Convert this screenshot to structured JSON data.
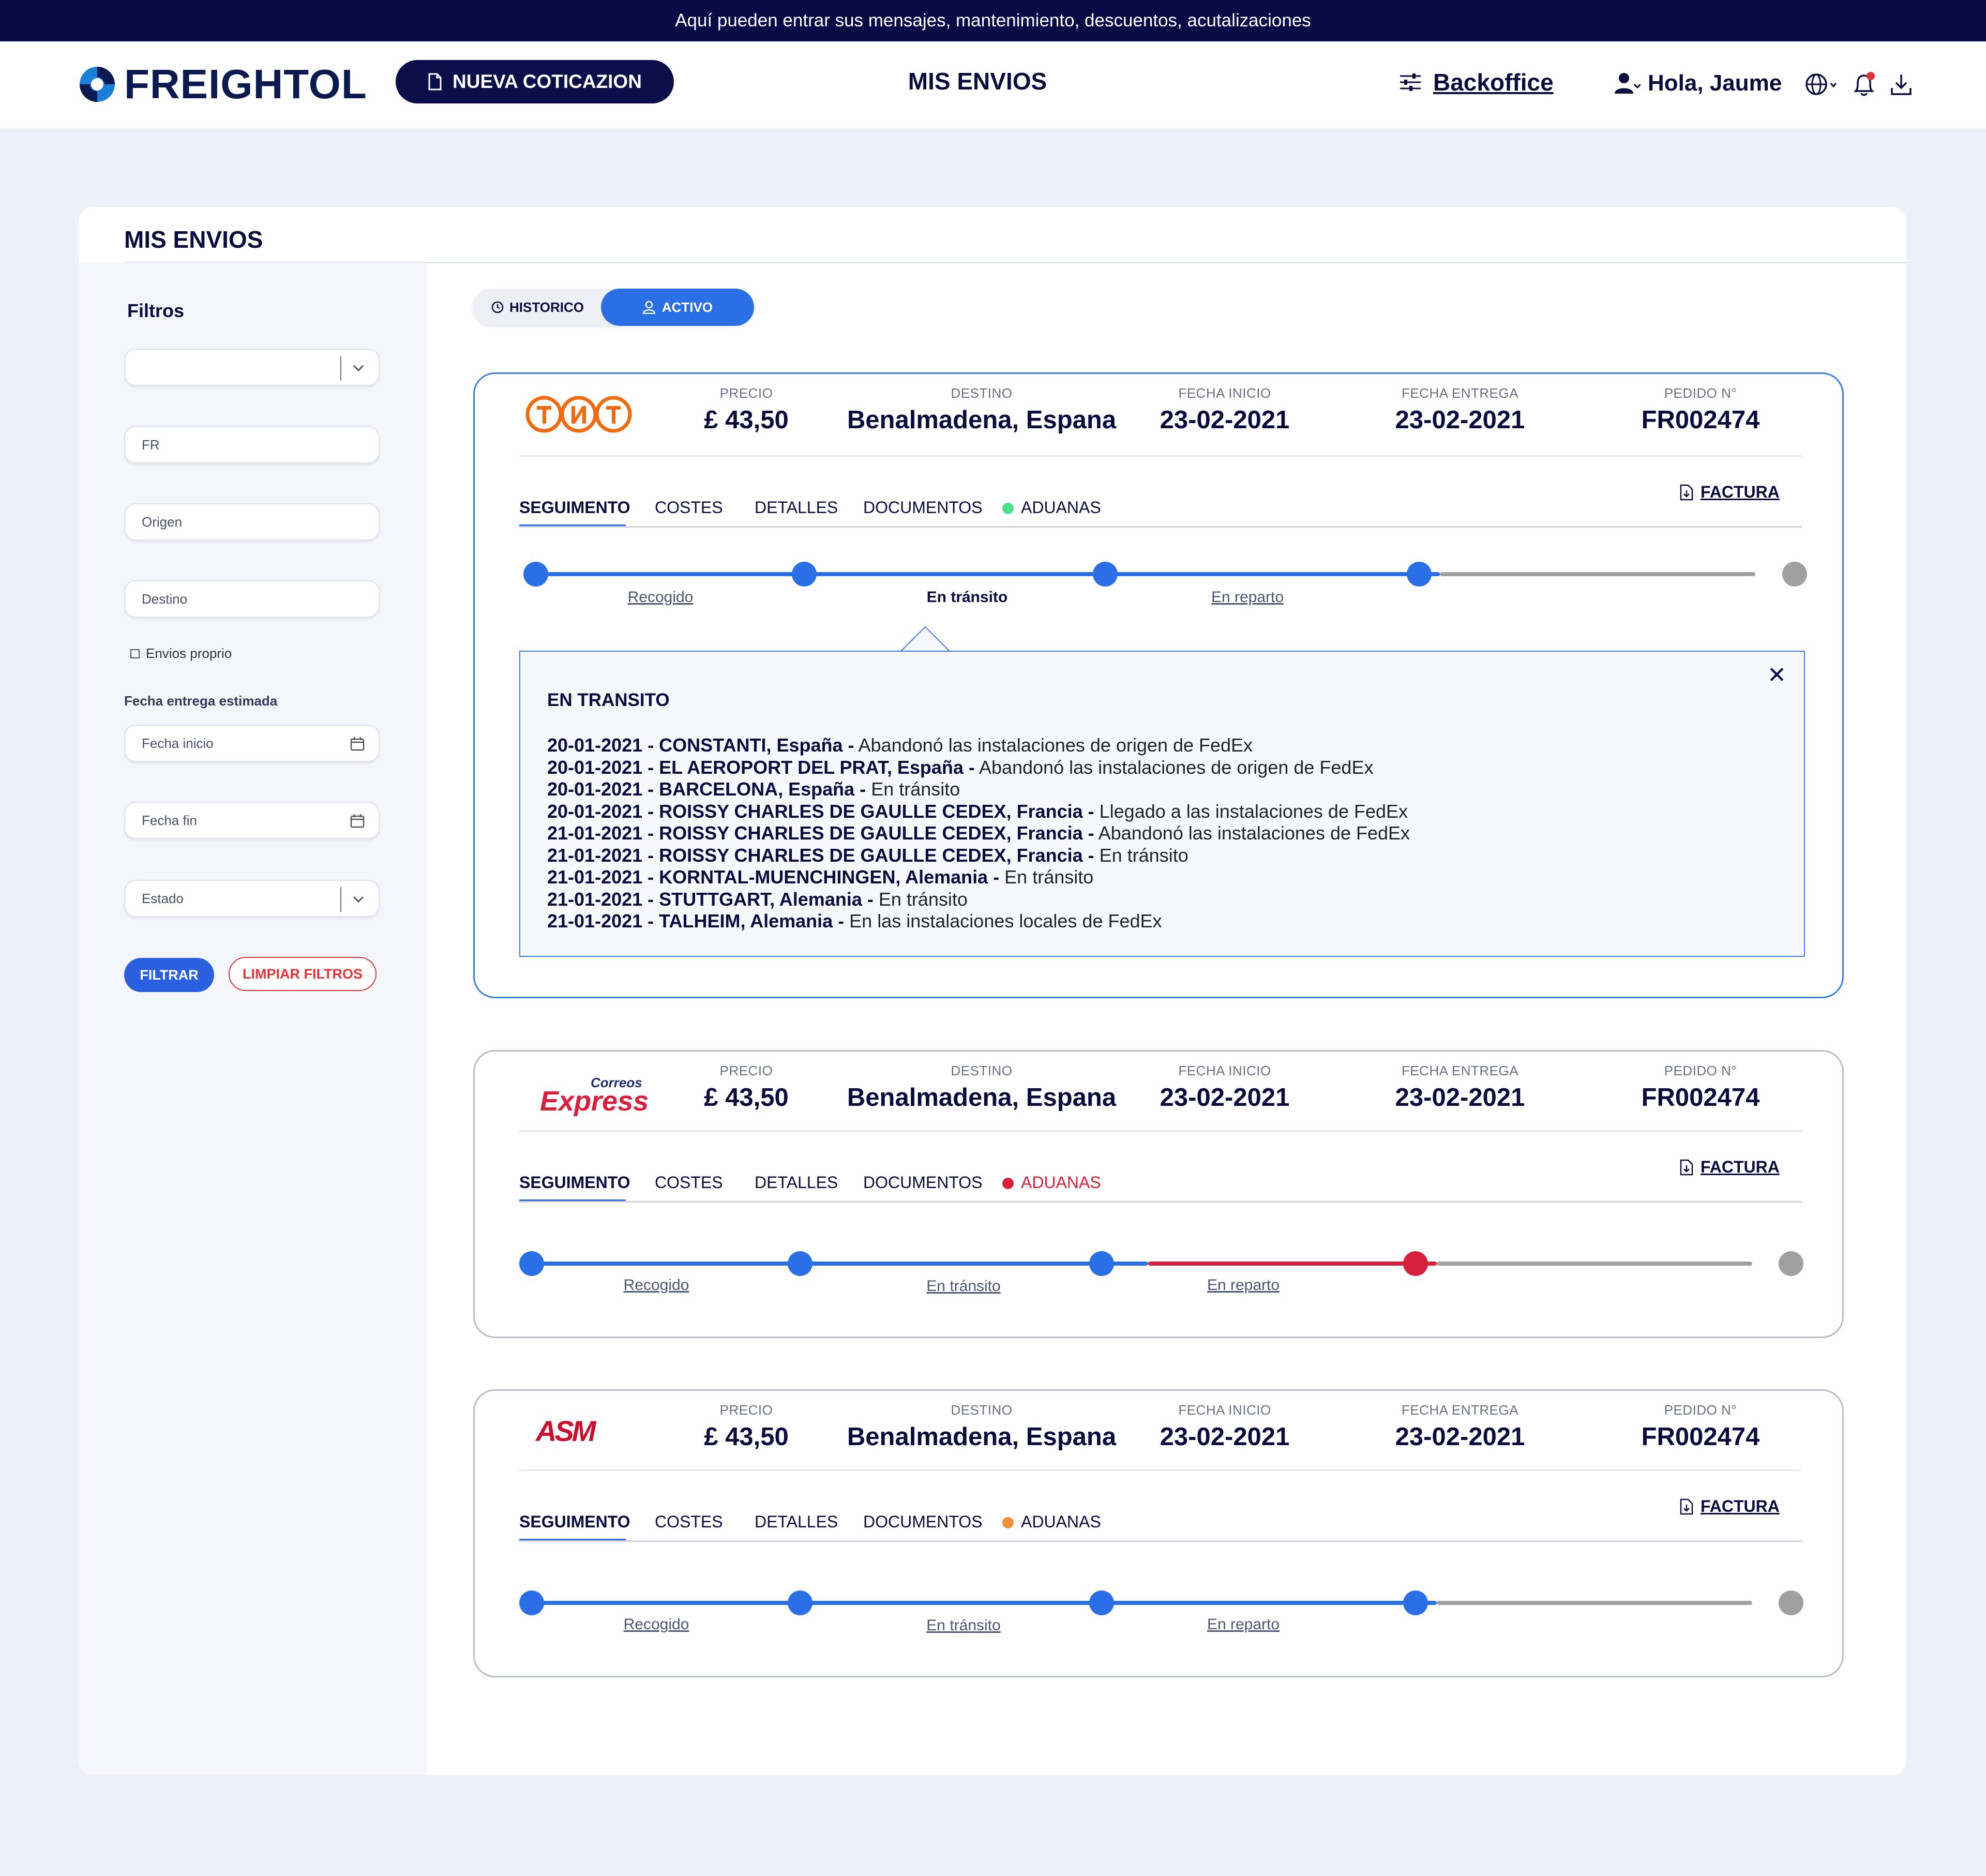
{
  "banner": "Aquí pueden entrar sus mensajes, mantenimiento, descuentos, acutalizaciones",
  "header": {
    "logo": "FREIGHTOL",
    "new_quote": "NUEVA COTICAZION",
    "nav_title": "MIS ENVIOS",
    "backoffice": "Backoffice",
    "greeting": "Hola, Jaume"
  },
  "page": {
    "title": "MIS ENVIOS"
  },
  "filters": {
    "title": "Filtros",
    "select_value": "",
    "fr_placeholder": "FR",
    "origin_placeholder": "Origen",
    "dest_placeholder": "Destino",
    "own_checkbox": "Envios proprio",
    "date_label": "Fecha entrega estimada",
    "date_start": "Fecha inicio",
    "date_end": "Fecha fin",
    "state_select": "Estado",
    "filter_btn": "FILTRAR",
    "clear_btn": "LIMPIAR FILTROS"
  },
  "toggle": {
    "historic": "HISTORICO",
    "active": "ACTIVO"
  },
  "labels": {
    "precio": "PRECIO",
    "destino": "DESTINO",
    "fecha_inicio": "FECHA INICIO",
    "fecha_entrega": "FECHA ENTREGA",
    "pedido": "PEDIDO N°"
  },
  "tabs": {
    "seguimiento": "SEGUIMENTO",
    "costes": "COSTES",
    "detalles": "DETALLES",
    "documentos": "DOCUMENTOS",
    "aduanas": "ADUANAS",
    "factura": "FACTURA"
  },
  "stages": {
    "recogido": "Recogido",
    "transito": "En tránsito",
    "reparto": "En reparto"
  },
  "shipments": [
    {
      "carrier": "TNT",
      "price": "£ 43,50",
      "destination": "Benalmadena, Espana",
      "start_date": "23-02-2021",
      "delivery_date": "23-02-2021",
      "order": "FR002474",
      "customs_status_color": "#4ee08a"
    },
    {
      "carrier_small": "Correos",
      "carrier": "Express",
      "price": "£ 43,50",
      "destination": "Benalmadena, Espana",
      "start_date": "23-02-2021",
      "delivery_date": "23-02-2021",
      "order": "FR002474",
      "customs_status_color": "#d8203c"
    },
    {
      "carrier": "ASM",
      "price": "£ 43,50",
      "destination": "Benalmadena, Espana",
      "start_date": "23-02-2021",
      "delivery_date": "23-02-2021",
      "order": "FR002474",
      "customs_status_color": "#f2913a"
    }
  ],
  "transit_detail": {
    "title": "EN TRANSITO",
    "events": [
      {
        "head": "20-01-2021 - CONSTANTI, España -",
        "text": " Abandonó las instalaciones de origen de FedEx"
      },
      {
        "head": "20-01-2021 - EL AEROPORT DEL PRAT, España -",
        "text": " Abandonó las instalaciones de origen de FedEx"
      },
      {
        "head": "20-01-2021 - BARCELONA, España -",
        "text": " En tránsito"
      },
      {
        "head": "20-01-2021 - ROISSY CHARLES DE GAULLE CEDEX, Francia -",
        "text": " Llegado a las instalaciones de FedEx"
      },
      {
        "head": "21-01-2021 - ROISSY CHARLES DE GAULLE CEDEX, Francia -",
        "text": " Abandonó las instalaciones de FedEx"
      },
      {
        "head": "21-01-2021 - ROISSY CHARLES DE GAULLE CEDEX, Francia -",
        "text": " En tránsito"
      },
      {
        "head": "21-01-2021 - KORNTAL-MUENCHINGEN, Alemania -",
        "text": " En tránsito"
      },
      {
        "head": "21-01-2021 - STUTTGART, Alemania -",
        "text": " En tránsito"
      },
      {
        "head": "21-01-2021 - TALHEIM, Alemania -",
        "text": " En las instalaciones locales de FedEx"
      }
    ]
  },
  "colors": {
    "brand_dark": "#080a45",
    "accent_blue": "#2a6fe6",
    "alert_red": "#d8203c",
    "pending_gray": "#a0a0a0"
  }
}
